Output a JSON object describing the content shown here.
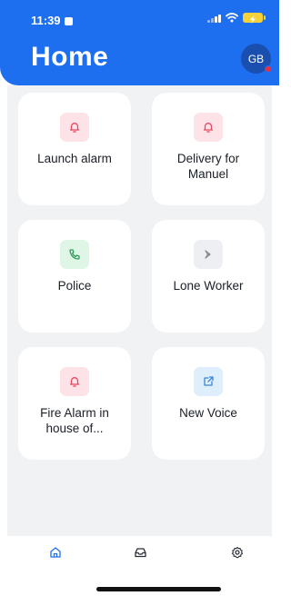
{
  "status_bar": {
    "time": "11:39"
  },
  "header": {
    "title": "Home",
    "avatar_initials": "GB"
  },
  "cards": [
    {
      "label": "Launch alarm",
      "icon": "bell-icon",
      "color": "#e5485f"
    },
    {
      "label": "Delivery for Manuel",
      "icon": "bell-icon",
      "color": "#e5485f"
    },
    {
      "label": "Police",
      "icon": "phone-icon",
      "color": "#2f9d5a"
    },
    {
      "label": "Lone Worker",
      "icon": "chevron-right-icon",
      "color": "#8a8f99"
    },
    {
      "label": "Fire Alarm in house of...",
      "icon": "bell-icon",
      "color": "#e5485f"
    },
    {
      "label": "New Voice",
      "icon": "external-link-icon",
      "color": "#3a86d4"
    }
  ],
  "tabbar": [
    {
      "icon": "home-icon",
      "color": "#1e6ff0"
    },
    {
      "icon": "inbox-icon",
      "color": "#2b2f38"
    },
    {
      "icon": "gear-icon",
      "color": "#2b2f38"
    }
  ],
  "colors": {
    "accent": "#1e6ff0",
    "background": "#f1f2f4",
    "notification": "#ef2b3c"
  }
}
